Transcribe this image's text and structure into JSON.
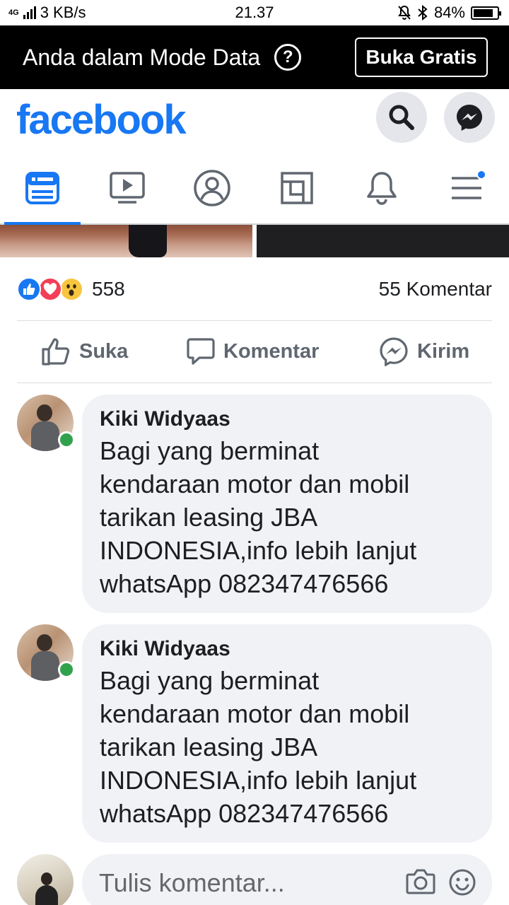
{
  "status_bar": {
    "network": "4G",
    "speed": "3 KB/s",
    "time": "21.37",
    "battery": "84%",
    "battery_level": 0.84
  },
  "data_mode": {
    "text": "Anda dalam Mode Data",
    "help_symbol": "?",
    "button_label": "Buka Gratis"
  },
  "header": {
    "logo": "facebook",
    "brand_color": "#1877f2",
    "search_icon": "search-icon",
    "messenger_icon": "messenger-icon"
  },
  "tabs": [
    {
      "name": "news-feed",
      "icon": "news-feed-icon",
      "active": true
    },
    {
      "name": "watch",
      "icon": "video-icon",
      "active": false
    },
    {
      "name": "profile",
      "icon": "profile-icon",
      "active": false
    },
    {
      "name": "pages",
      "icon": "pages-icon",
      "active": false
    },
    {
      "name": "notifications",
      "icon": "bell-icon",
      "active": false
    },
    {
      "name": "menu",
      "icon": "menu-icon",
      "active": false,
      "badge": true
    }
  ],
  "post": {
    "reaction_count": "558",
    "comment_count": "55 Komentar",
    "actions": {
      "like": "Suka",
      "comment": "Komentar",
      "send": "Kirim"
    }
  },
  "comments": [
    {
      "author": "Kiki Widyaas",
      "text_lines": [
        "Bagi yang berminat",
        "kendaraan motor dan mobil",
        "tarikan leasing JBA",
        "INDONESIA,info lebih lanjut",
        "whatsApp 082347476566"
      ],
      "online": true
    },
    {
      "author": "Kiki Widyaas",
      "text_lines": [
        "Bagi yang berminat",
        "kendaraan motor dan mobil",
        "tarikan leasing JBA",
        "INDONESIA,info lebih lanjut",
        "whatsApp 082347476566"
      ],
      "online": true
    }
  ],
  "composer": {
    "placeholder": "Tulis komentar..."
  }
}
